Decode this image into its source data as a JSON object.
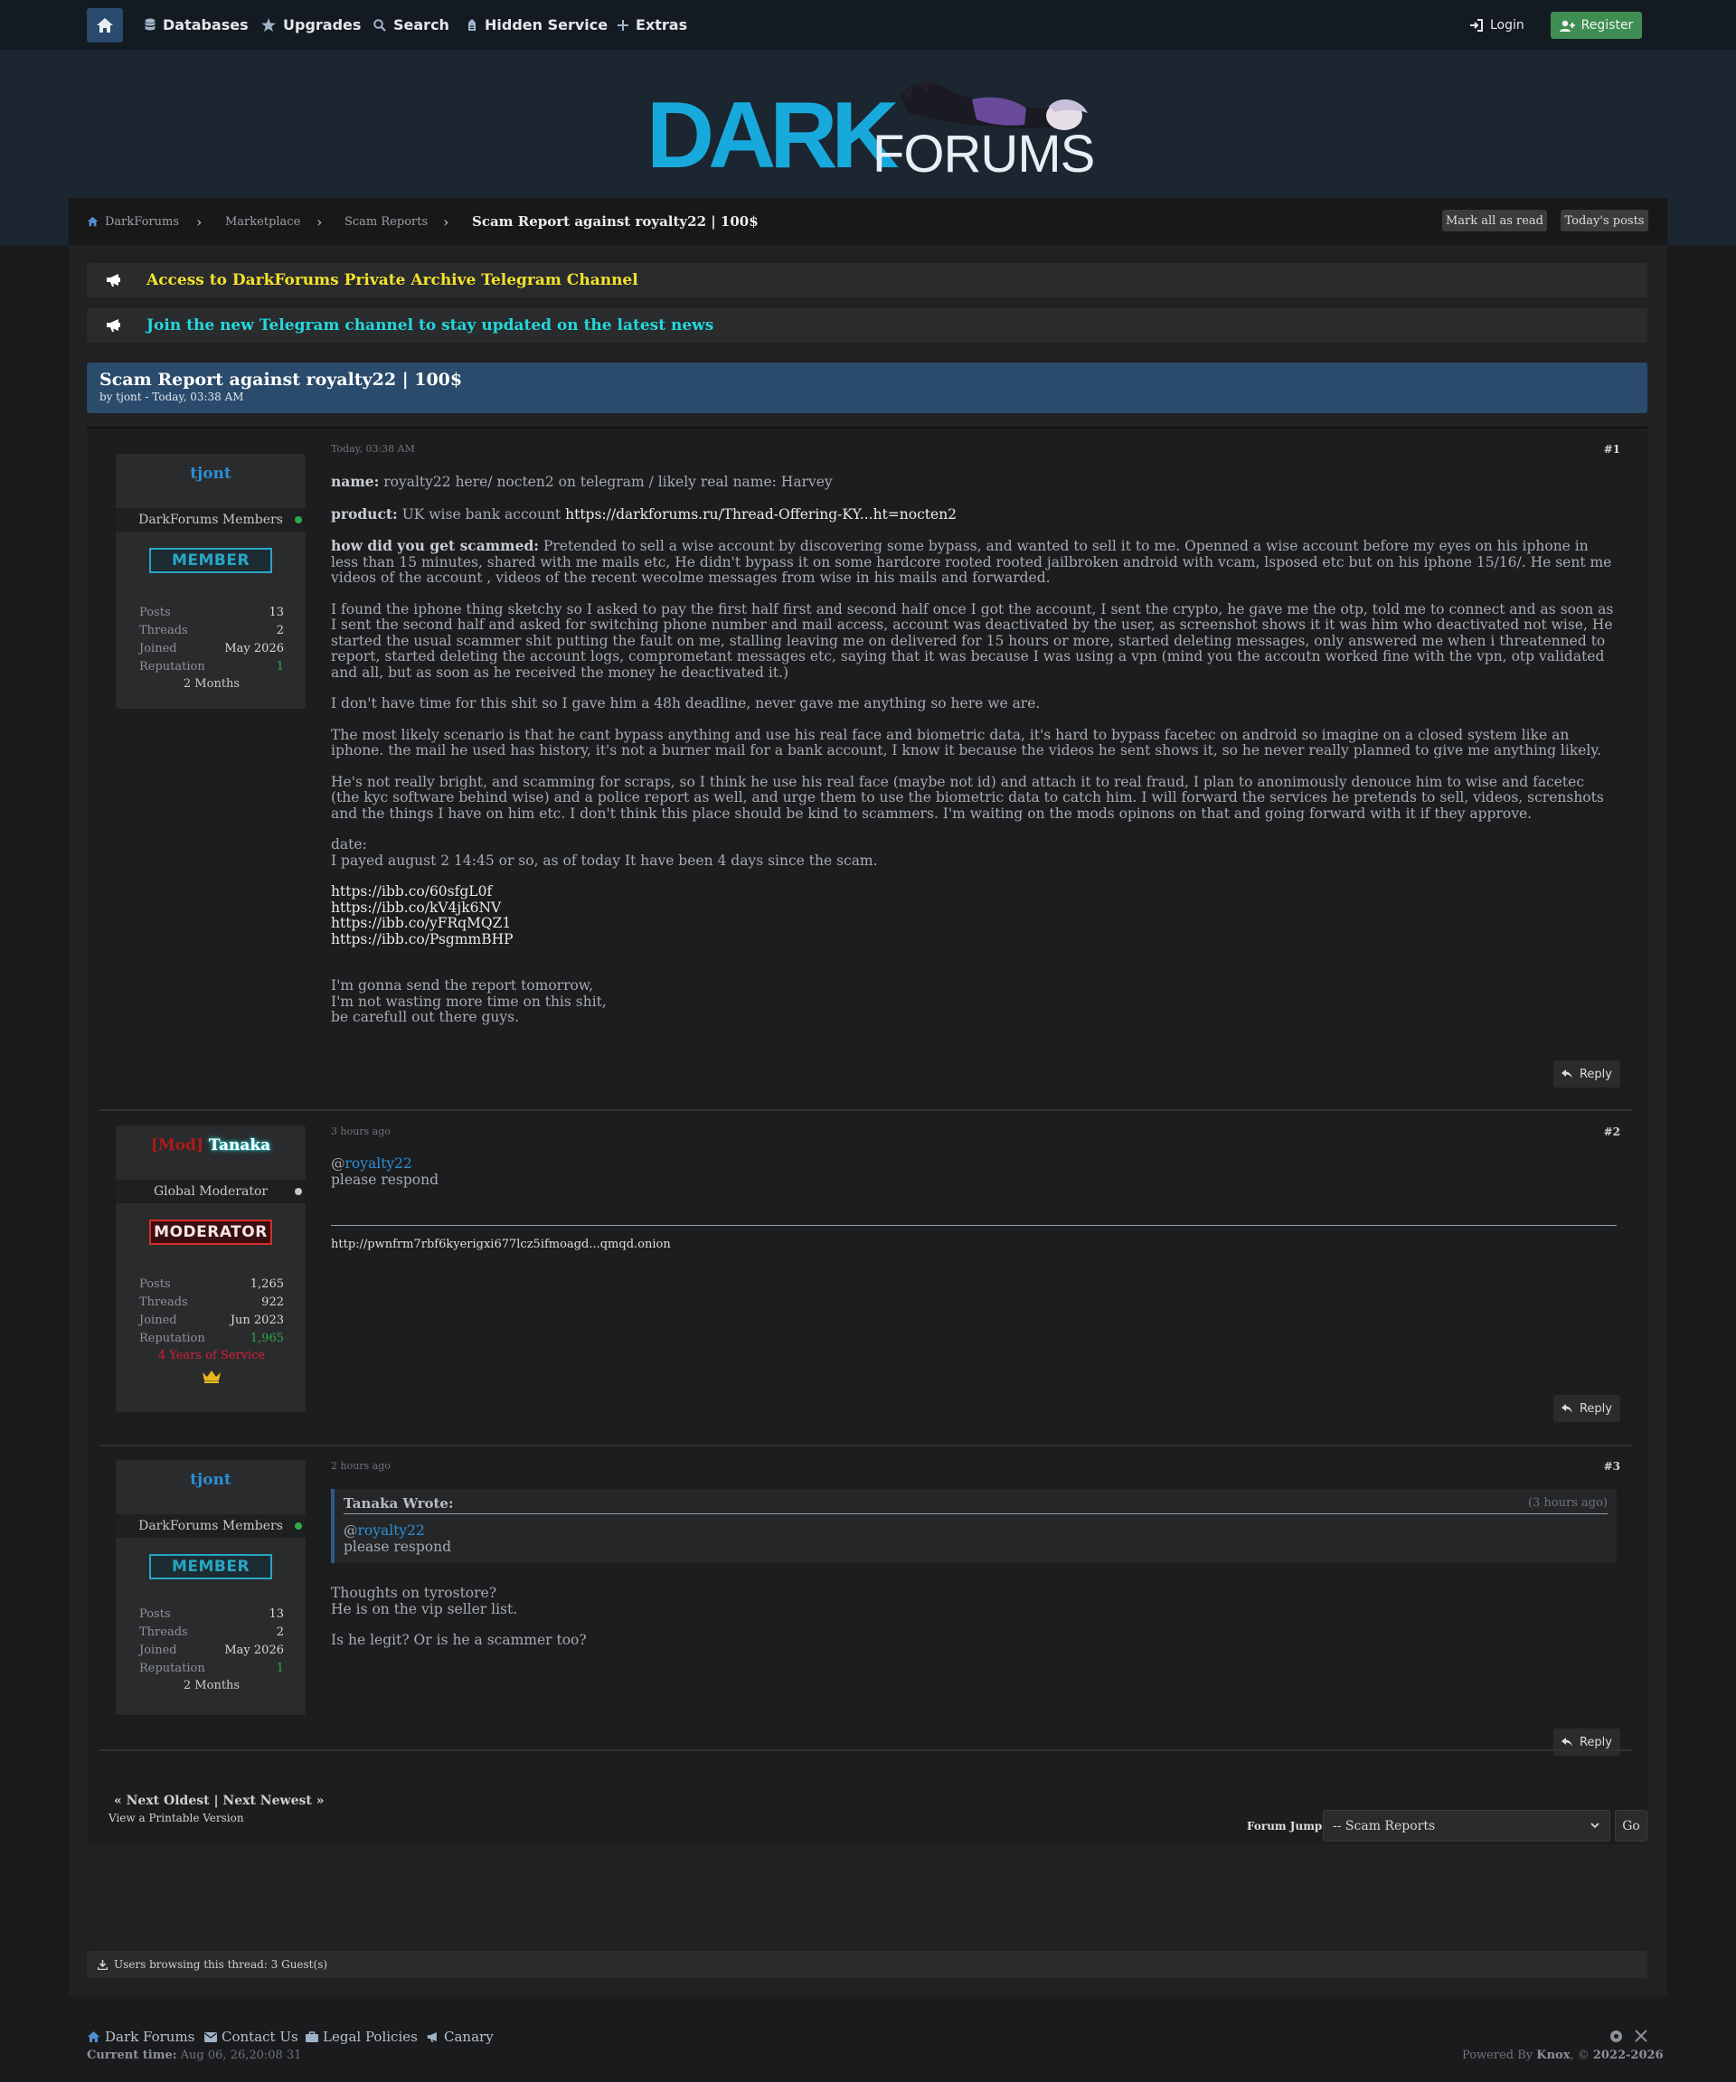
{
  "nav": {
    "items": [
      {
        "label": "Databases",
        "icon": "database-icon"
      },
      {
        "label": "Upgrades",
        "icon": "star-icon"
      },
      {
        "label": "Search",
        "icon": "search-icon"
      },
      {
        "label": "Hidden Service",
        "icon": "onion-icon"
      },
      {
        "label": "Extras",
        "icon": "plus-icon"
      }
    ],
    "login": "Login",
    "register": "Register"
  },
  "logo": {
    "part1": "DARK",
    "part2": "FORUMS"
  },
  "breadcrumb": {
    "items": [
      "DarkForums",
      "Marketplace",
      "Scam Reports"
    ],
    "current": "Scam Report against royalty22 | 100$",
    "mark_read": "Mark all as read",
    "todays_posts": "Today's posts"
  },
  "announcements": [
    {
      "text": "Access to DarkForums Private Archive Telegram Channel",
      "color": "#f2e22a"
    },
    {
      "text": "Join the new Telegram channel to stay updated on the latest news",
      "color": "#22d8dc"
    }
  ],
  "thread": {
    "title": "Scam Report against royalty22 | 100$",
    "byline": "by tjont - Today, 03:38 AM"
  },
  "posts": [
    {
      "number": "#1",
      "time": "Today, 03:38 AM",
      "author": {
        "name": "tjont",
        "group": "DarkForums Members",
        "badge": "MEMBER",
        "stats": [
          {
            "label": "Posts",
            "value": "13"
          },
          {
            "label": "Threads",
            "value": "2"
          },
          {
            "label": "Joined",
            "value": "May 2026"
          },
          {
            "label": "Reputation",
            "value": "1"
          }
        ],
        "footer": "2 Months"
      },
      "name_label": "name:",
      "name_text": "royalty22 here/ nocten2 on telegram / likely real name: Harvey",
      "product_label": "product:",
      "product_text": "UK wise bank account",
      "product_link": "https://darkforums.ru/Thread-Offering-KY...ht=nocten2",
      "how_label": "how did you get scammed:",
      "how_text": "Pretended to sell a wise account by discovering some bypass, and wanted to sell it to me. Openned a wise account before my eyes on his iphone in less than 15 minutes, shared with me mails etc, He didn't bypass it on some hardcore rooted  rooted jailbroken android with vcam, lsposed etc but on his iphone 15/16/. He sent me videos of the account ,  videos of the recent wecolme messages from wise in his mails and forwarded.",
      "para1": "I found the iphone thing sketchy so I asked to pay the first half first and second half once I got the account, I sent  the crypto, he gave me the otp, told me to connect and as soon as I sent the second half and asked for switching phone number and mail access, account was deactivated by the user, as screenshot shows it it was him who deactivated not wise, He started the usual scammer shit putting the fault on me, stalling leaving me on delivered for 15 hours or more, started deleting messages, only answered me when i threatenned to report, started deleting the account logs, comprometant messages etc, saying that it was because I was using a vpn (mind you the accoutn worked fine with the vpn, otp validated and all, but as soon as he received the money he deactivated it.)",
      "para2": "I don't have time for this shit so I gave him a 48h deadline, never gave me anything so here we are.",
      "para3": "The most likely scenario is that he cant bypass anything and use his real face and biometric data, it's hard to bypass facetec on android so imagine on  a closed system like an iphone. the mail he used has history, it's not a burner mail for a bank account, I know it because the videos he sent shows it, so he never really planned to give me anything likely.",
      "para4": "He's not really bright, and scamming for scraps, so I think he use his real face (maybe not id) and attach it to real fraud, I plan to anonimously denouce him to wise and facetec (the kyc software behind wise) and a police report as well, and urge them to use the biometric data to catch him. I will forward the services he pretends to sell, videos, screnshots and the things I have on him etc. I don't think this place should be kind to scammers. I'm waiting on the mods opinons on that and going forward with it if they approve.",
      "date_label": "date:",
      "date_text": "I payed august 2 14:45 or so, as of today It have been 4 days since the scam.",
      "links": [
        "https://ibb.co/60sfgL0f",
        "https://ibb.co/kV4jk6NV",
        "https://ibb.co/yFRqMQZ1",
        "https://ibb.co/PsgmmBHP"
      ],
      "closing": [
        "I'm gonna send the report tomorrow,",
        "I'm not wasting more time on this shit,",
        "be carefull out there guys."
      ],
      "reply": "Reply"
    },
    {
      "number": "#2",
      "time": "3 hours ago",
      "author": {
        "name_prefix": "[Mod]",
        "name": "Tanaka",
        "group": "Global Moderator",
        "badge": "MODERATOR",
        "stats": [
          {
            "label": "Posts",
            "value": "1,265"
          },
          {
            "label": "Threads",
            "value": "922"
          },
          {
            "label": "Joined",
            "value": "Jun 2023"
          },
          {
            "label": "Reputation",
            "value": "1,965"
          }
        ],
        "footer": "4 Years of Service"
      },
      "mention": "royalty22",
      "text": "please respond",
      "signature": "http://pwnfrm7rbf6kyerigxi677lcz5ifmoagd...qmqd.onion",
      "reply": "Reply"
    },
    {
      "number": "#3",
      "time": "2 hours ago",
      "author": {
        "name": "tjont",
        "group": "DarkForums Members",
        "badge": "MEMBER",
        "stats": [
          {
            "label": "Posts",
            "value": "13"
          },
          {
            "label": "Threads",
            "value": "2"
          },
          {
            "label": "Joined",
            "value": "May 2026"
          },
          {
            "label": "Reputation",
            "value": "1"
          }
        ],
        "footer": "2 Months"
      },
      "quote": {
        "author": "Tanaka Wrote:",
        "time": "(3 hours ago)",
        "mention": "royalty22",
        "text": "please respond"
      },
      "lines": [
        "Thoughts on tyrostore?",
        "He is on the vip seller list."
      ],
      "line3": "Is he legit? Or is he a scammer too?",
      "reply": "Reply"
    }
  ],
  "pager": "« Next Oldest | Next Newest »",
  "printable": "View a Printable Version",
  "forum_jump": {
    "label": "Forum Jump:",
    "selected": "-- Scam Reports",
    "go": "Go"
  },
  "browsing": "Users browsing this thread: 3 Guest(s)",
  "footer": {
    "links": [
      "Dark Forums",
      "Contact Us",
      "Legal Policies",
      "Canary"
    ],
    "current_time_label": "Current time:",
    "current_time": "Aug 06, 26,20:08 31",
    "powered_prefix": "Powered By",
    "powered_name": "Knox",
    "powered_suffix": ", ©",
    "powered_years": "2022-2026"
  },
  "colors": {
    "accent": "#2a4b6e",
    "member": "#28a7c4",
    "mod": "#d82c2c",
    "online": "#2ea84a"
  }
}
